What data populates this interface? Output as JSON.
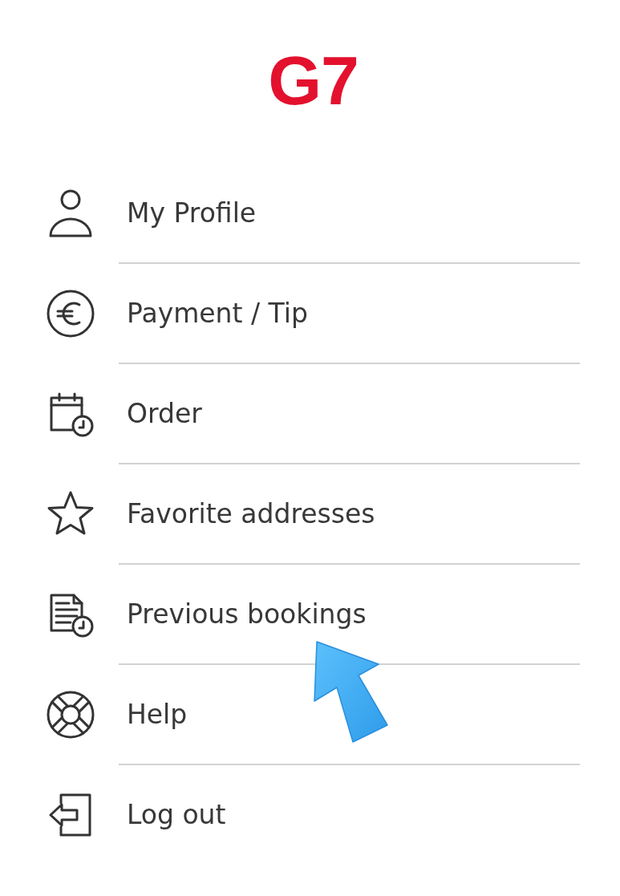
{
  "logo": {
    "text": "G7"
  },
  "menu": {
    "items": [
      {
        "label": "My Profile"
      },
      {
        "label": "Payment / Tip"
      },
      {
        "label": "Order"
      },
      {
        "label": "Favorite addresses"
      },
      {
        "label": "Previous bookings"
      },
      {
        "label": "Help"
      },
      {
        "label": "Log out"
      }
    ]
  }
}
